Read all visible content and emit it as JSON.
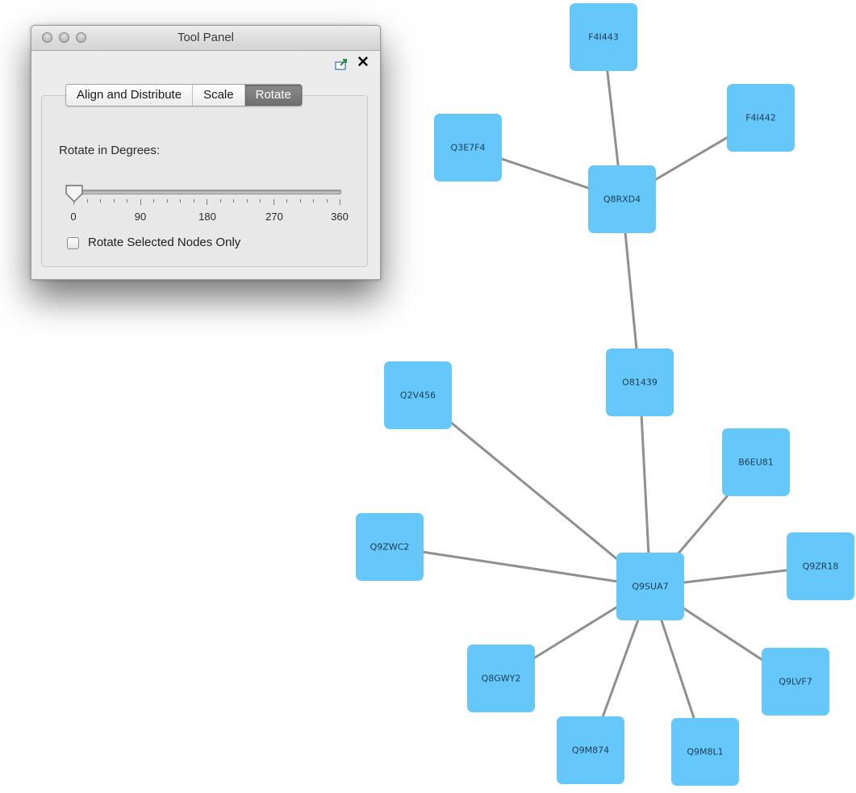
{
  "tool_panel": {
    "title": "Tool Panel",
    "tabs": [
      {
        "label": "Align and Distribute",
        "active": false
      },
      {
        "label": "Scale",
        "active": false
      },
      {
        "label": "Rotate",
        "active": true
      }
    ],
    "rotate_label": "Rotate in Degrees:",
    "slider": {
      "min": 0,
      "max": 360,
      "value": 0,
      "tick_labels": [
        "0",
        "90",
        "180",
        "270",
        "360"
      ]
    },
    "checkbox": {
      "label": "Rotate Selected Nodes Only",
      "checked": false
    },
    "icons": [
      "float-window-icon",
      "close-icon"
    ]
  },
  "network": {
    "node_color": "#66c8fa",
    "edge_color": "#8f8f8f",
    "nodes": [
      {
        "id": "F4I443"
      },
      {
        "id": "F4I442"
      },
      {
        "id": "Q3E7F4"
      },
      {
        "id": "Q8RXD4"
      },
      {
        "id": "O81439"
      },
      {
        "id": "Q2V456"
      },
      {
        "id": "B6EU81"
      },
      {
        "id": "Q9ZWC2"
      },
      {
        "id": "Q9SUA7"
      },
      {
        "id": "Q9ZR18"
      },
      {
        "id": "Q8GWY2"
      },
      {
        "id": "Q9LVF7"
      },
      {
        "id": "Q9M874"
      },
      {
        "id": "Q9M8L1"
      }
    ],
    "edges": [
      [
        "F4I443",
        "Q8RXD4"
      ],
      [
        "F4I442",
        "Q8RXD4"
      ],
      [
        "Q3E7F4",
        "Q8RXD4"
      ],
      [
        "Q8RXD4",
        "O81439"
      ],
      [
        "O81439",
        "Q9SUA7"
      ],
      [
        "Q2V456",
        "Q9SUA7"
      ],
      [
        "B6EU81",
        "Q9SUA7"
      ],
      [
        "Q9ZWC2",
        "Q9SUA7"
      ],
      [
        "Q9ZR18",
        "Q9SUA7"
      ],
      [
        "Q8GWY2",
        "Q9SUA7"
      ],
      [
        "Q9LVF7",
        "Q9SUA7"
      ],
      [
        "Q9M874",
        "Q9SUA7"
      ],
      [
        "Q9M8L1",
        "Q9SUA7"
      ]
    ]
  }
}
